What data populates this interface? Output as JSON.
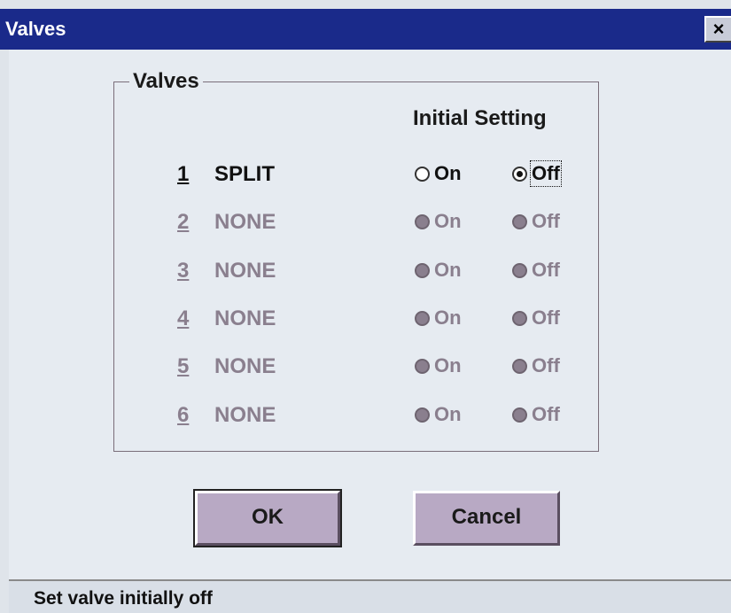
{
  "window": {
    "title": "Valves",
    "close_label": "×"
  },
  "group": {
    "legend": "Valves",
    "column_header": "Initial Setting"
  },
  "valves": [
    {
      "num": "1",
      "name": "SPLIT",
      "on_label": "On",
      "off_label": "Off",
      "state": "off",
      "enabled": true
    },
    {
      "num": "2",
      "name": "NONE",
      "on_label": "On",
      "off_label": "Off",
      "state": "none",
      "enabled": false
    },
    {
      "num": "3",
      "name": "NONE",
      "on_label": "On",
      "off_label": "Off",
      "state": "none",
      "enabled": false
    },
    {
      "num": "4",
      "name": "NONE",
      "on_label": "On",
      "off_label": "Off",
      "state": "none",
      "enabled": false
    },
    {
      "num": "5",
      "name": "NONE",
      "on_label": "On",
      "off_label": "Off",
      "state": "none",
      "enabled": false
    },
    {
      "num": "6",
      "name": "NONE",
      "on_label": "On",
      "off_label": "Off",
      "state": "none",
      "enabled": false
    }
  ],
  "buttons": {
    "ok_label": "OK",
    "cancel_label": "Cancel"
  },
  "status": {
    "text": "Set valve initially off"
  },
  "colors": {
    "title_bar": "#1a2a8a",
    "dialog_bg": "#e6ebf1",
    "button_face": "#b8a9c4",
    "disabled_text": "#8a7f8e"
  }
}
